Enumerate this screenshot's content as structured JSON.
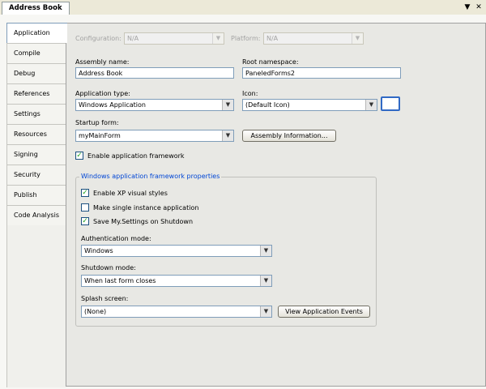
{
  "document_tab": {
    "title": "Address Book"
  },
  "window_controls": {
    "dropdown_icon": "chevron-down-icon",
    "close_icon": "close-icon",
    "dropdown_glyph": "▼",
    "close_glyph": "✕"
  },
  "side_tabs": [
    {
      "label": "Application",
      "active": true
    },
    {
      "label": "Compile"
    },
    {
      "label": "Debug"
    },
    {
      "label": "References"
    },
    {
      "label": "Settings"
    },
    {
      "label": "Resources"
    },
    {
      "label": "Signing"
    },
    {
      "label": "Security"
    },
    {
      "label": "Publish"
    },
    {
      "label": "Code Analysis"
    }
  ],
  "configuration": {
    "label": "Configuration:",
    "value": "N/A"
  },
  "platform": {
    "label": "Platform:",
    "value": "N/A"
  },
  "assembly_name": {
    "label": "Assembly name:",
    "value": "Address Book"
  },
  "root_namespace": {
    "label": "Root namespace:",
    "value": "PaneledForms2"
  },
  "application_type": {
    "label": "Application type:",
    "value": "Windows Application"
  },
  "icon": {
    "label": "Icon:",
    "value": "(Default Icon)"
  },
  "startup_form": {
    "label": "Startup form:",
    "value": "myMainForm"
  },
  "assembly_info_button": "Assembly Information...",
  "enable_framework": {
    "label": "Enable application framework",
    "checked": true
  },
  "framework_group": {
    "title": "Windows application framework properties",
    "xp_styles": {
      "label": "Enable XP visual styles",
      "checked": true
    },
    "single_instance": {
      "label": "Make single instance application",
      "checked": false
    },
    "save_settings": {
      "label": "Save My.Settings on Shutdown",
      "checked": true
    },
    "auth_mode": {
      "label": "Authentication mode:",
      "value": "Windows"
    },
    "shutdown_mode": {
      "label": "Shutdown mode:",
      "value": "When last form closes"
    },
    "splash_screen": {
      "label": "Splash screen:",
      "value": "(None)"
    },
    "view_events_button": "View Application Events"
  },
  "check_glyph": "✓",
  "combo_arrow_glyph": "▼"
}
